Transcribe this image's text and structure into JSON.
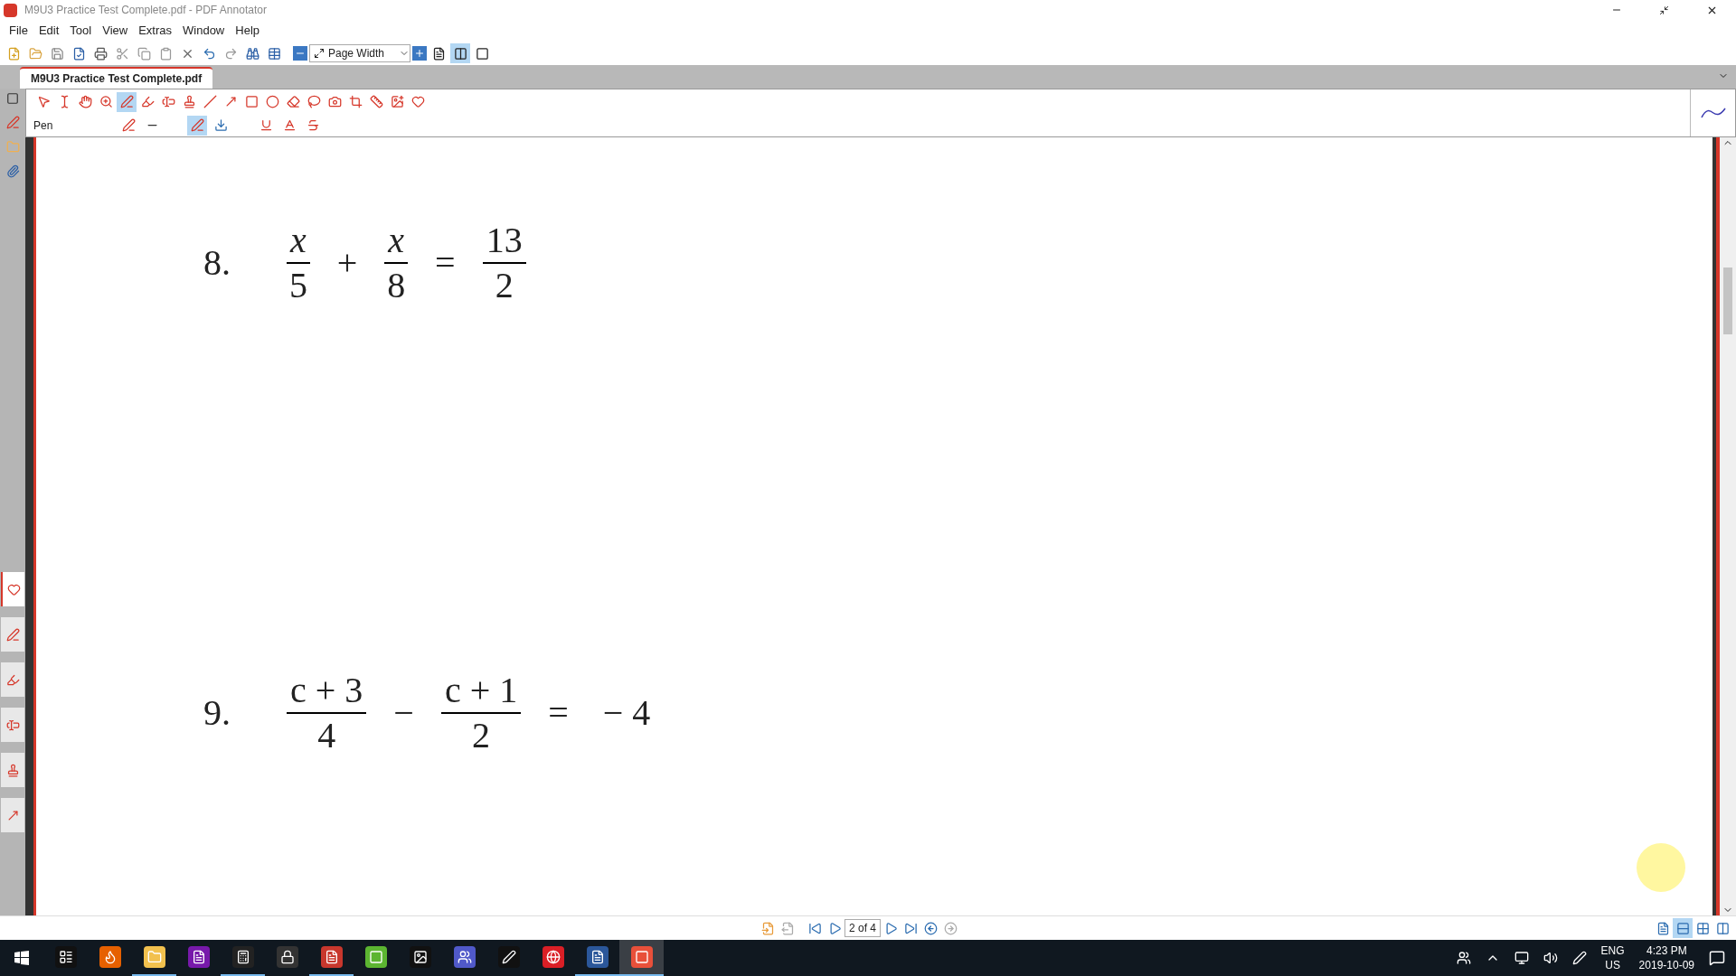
{
  "window": {
    "title": "M9U3 Practice Test Complete.pdf - PDF Annotator"
  },
  "menu": [
    "File",
    "Edit",
    "Tool",
    "View",
    "Extras",
    "Window",
    "Help"
  ],
  "zoom_box": {
    "value": "Page Width"
  },
  "view_buttons": [
    {
      "selected": false
    },
    {
      "selected": true
    },
    {
      "selected": false
    }
  ],
  "tab": {
    "label": "M9U3 Practice Test Complete.pdf",
    "selected": true
  },
  "annotation_tools": [
    {
      "selected": false
    },
    {
      "selected": false
    },
    {
      "selected": false
    },
    {
      "selected": false
    },
    {
      "selected": true
    },
    {
      "selected": false
    },
    {
      "selected": false
    },
    {
      "selected": false
    },
    {
      "selected": false
    },
    {
      "selected": false
    },
    {
      "selected": false
    },
    {
      "selected": false
    },
    {
      "selected": false
    },
    {
      "selected": false
    },
    {
      "selected": false
    },
    {
      "selected": false
    },
    {
      "selected": false
    },
    {
      "selected": false
    },
    {
      "selected": false
    }
  ],
  "tool_options": {
    "label": "Pen",
    "smooth": true
  },
  "side_tabs": [
    {
      "selected": true
    },
    {
      "selected": false
    },
    {
      "selected": false
    },
    {
      "selected": false
    },
    {
      "selected": false
    },
    {
      "selected": false
    }
  ],
  "problems": [
    {
      "number": "8.",
      "terms": [
        {
          "kind": "fraction",
          "num": "x",
          "den": "5"
        },
        {
          "kind": "op",
          "text": "+"
        },
        {
          "kind": "fraction",
          "num": "x",
          "den": "8"
        },
        {
          "kind": "op",
          "text": "="
        },
        {
          "kind": "fraction",
          "num": "13",
          "den": "2"
        }
      ]
    },
    {
      "number": "9.",
      "terms": [
        {
          "kind": "fraction",
          "num": "c + 3",
          "den": "4"
        },
        {
          "kind": "op",
          "text": "−"
        },
        {
          "kind": "fraction",
          "num": "c + 1",
          "den": "2"
        },
        {
          "kind": "op",
          "text": "="
        },
        {
          "kind": "op",
          "text": "− 4"
        }
      ]
    }
  ],
  "page_nav": {
    "page": "2 of 4"
  },
  "layout_buttons": [
    {
      "selected": false
    },
    {
      "selected": true
    },
    {
      "selected": false
    },
    {
      "selected": false
    }
  ],
  "taskbar": {
    "apps": [
      {
        "running": false,
        "active": false
      },
      {
        "running": false,
        "active": false
      },
      {
        "running": true,
        "active": false
      },
      {
        "running": false,
        "active": false
      },
      {
        "running": true,
        "active": false
      },
      {
        "running": false,
        "active": false
      },
      {
        "running": true,
        "active": false
      },
      {
        "running": false,
        "active": false
      },
      {
        "running": false,
        "active": false
      },
      {
        "running": false,
        "active": false
      },
      {
        "running": false,
        "active": false
      },
      {
        "running": false,
        "active": false
      },
      {
        "running": true,
        "active": false
      },
      {
        "running": true,
        "active": true
      }
    ],
    "language": "ENG",
    "region": "US",
    "time": "4:23 PM",
    "date": "2019-10-09"
  }
}
